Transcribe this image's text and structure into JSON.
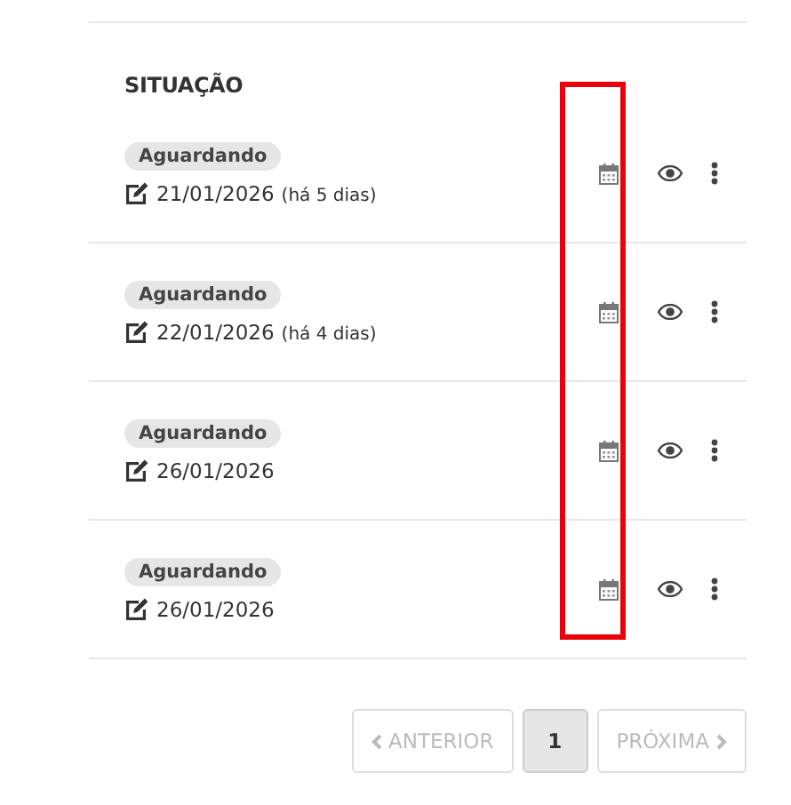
{
  "table": {
    "columns": [
      {
        "label": "SITUAÇÃO"
      }
    ],
    "rows": [
      {
        "status": "Aguardando",
        "date": "21/01/2026",
        "relative": "(há 5 dias)"
      },
      {
        "status": "Aguardando",
        "date": "22/01/2026",
        "relative": "(há 4 dias)"
      },
      {
        "status": "Aguardando",
        "date": "26/01/2026"
      },
      {
        "status": "Aguardando",
        "date": "26/01/2026"
      }
    ]
  },
  "highlight": {
    "on": true
  },
  "pagination": {
    "previous": {
      "label": "ANTERIOR",
      "disabled": true
    },
    "pages": [
      {
        "label": "1",
        "selected": true
      }
    ],
    "next": {
      "label": "PRÓXIMA",
      "disabled": true
    }
  }
}
